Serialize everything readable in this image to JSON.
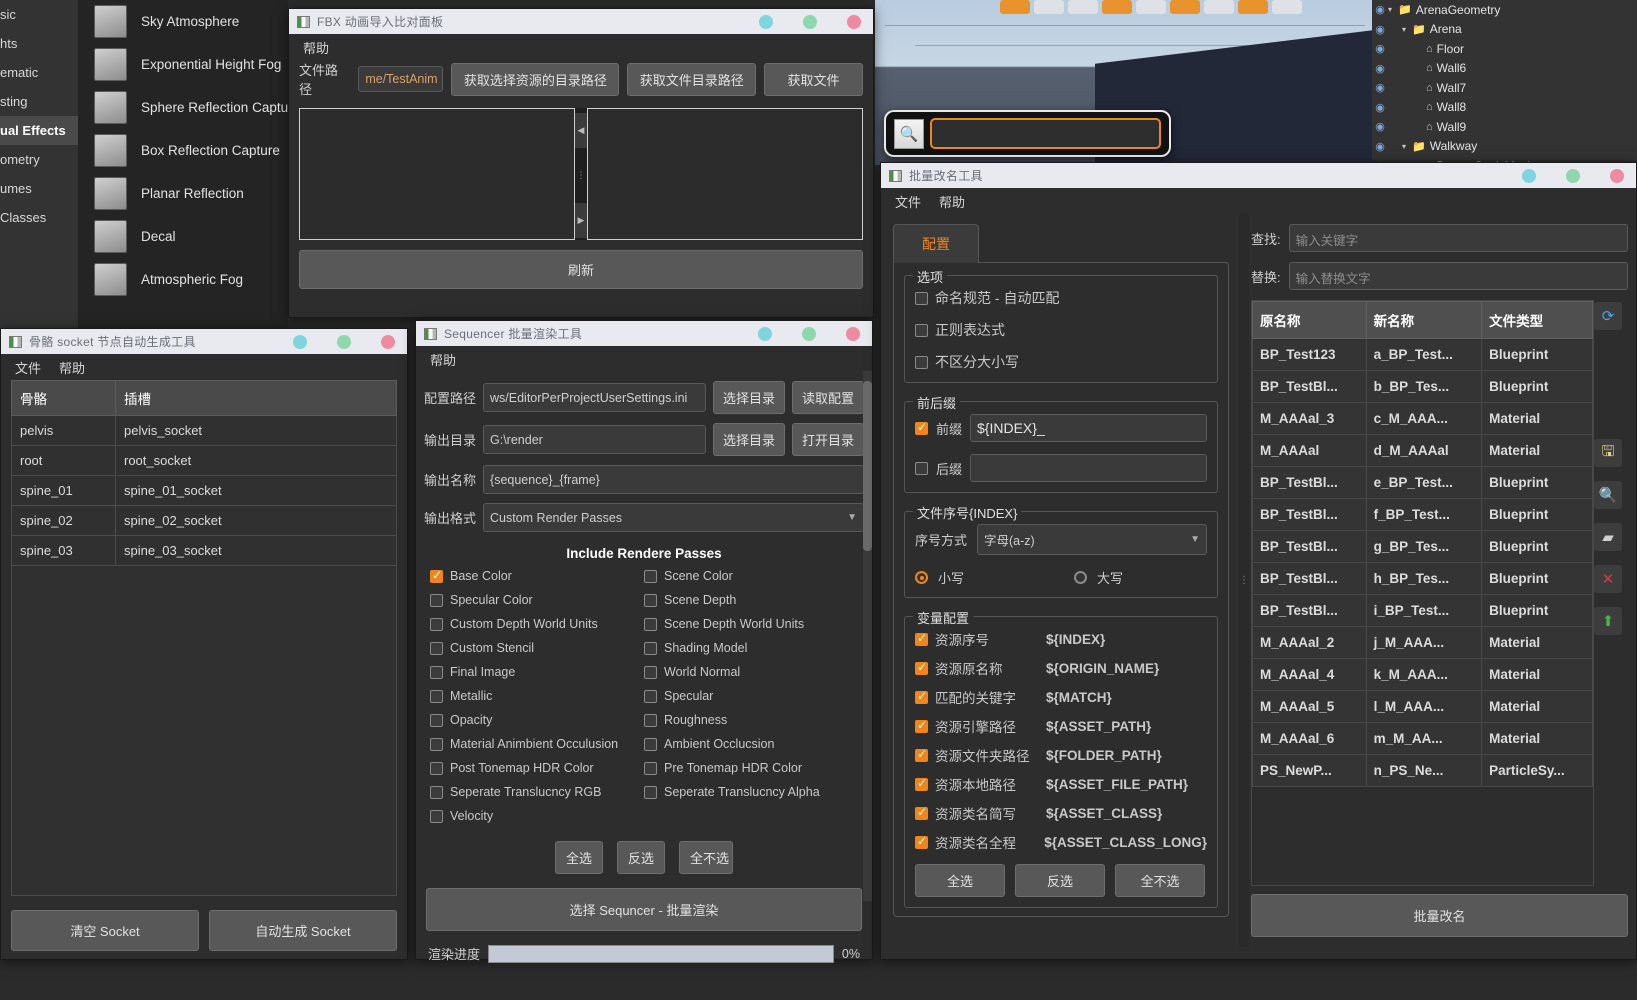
{
  "placement_panel": {
    "categories": [
      {
        "label": "sic",
        "selected": false
      },
      {
        "label": "hts",
        "selected": false
      },
      {
        "label": "ematic",
        "selected": false
      },
      {
        "label": "sting",
        "selected": false
      },
      {
        "label": "ual Effects",
        "selected": true
      },
      {
        "label": "ometry",
        "selected": false
      },
      {
        "label": "umes",
        "selected": false
      },
      {
        "label": "Classes",
        "selected": false
      }
    ],
    "items": [
      {
        "label": "Sky Atmosphere",
        "icon": "sky-atmosphere-icon"
      },
      {
        "label": "Exponential Height Fog",
        "icon": "height-fog-icon"
      },
      {
        "label": "Sphere Reflection Capture",
        "icon": "sphere-reflection-icon"
      },
      {
        "label": "Box Reflection Capture",
        "icon": "box-reflection-icon"
      },
      {
        "label": "Planar Reflection",
        "icon": "planar-reflection-icon"
      },
      {
        "label": "Decal",
        "icon": "decal-icon"
      },
      {
        "label": "Atmospheric Fog",
        "icon": "atmospheric-fog-icon"
      }
    ]
  },
  "outliner": {
    "rows": [
      {
        "label": "ArenaGeometry",
        "type": "folder",
        "indent": 0,
        "expander": true
      },
      {
        "label": "Arena",
        "type": "folder",
        "indent": 1,
        "expander": true
      },
      {
        "label": "Floor",
        "type": "mesh",
        "indent": 2,
        "expander": false
      },
      {
        "label": "Wall6",
        "type": "mesh",
        "indent": 2,
        "expander": false
      },
      {
        "label": "Wall7",
        "type": "mesh",
        "indent": 2,
        "expander": false
      },
      {
        "label": "Wall8",
        "type": "mesh",
        "indent": 2,
        "expander": false
      },
      {
        "label": "Wall9",
        "type": "mesh",
        "indent": 2,
        "expander": false
      },
      {
        "label": "Walkway",
        "type": "folder",
        "indent": 1,
        "expander": true
      },
      {
        "label": "Bump_StaticMesh",
        "type": "mesh",
        "indent": 2,
        "expander": false
      }
    ]
  },
  "search_overlay": {
    "icon": "asset-search-icon",
    "value": "",
    "placeholder": ""
  },
  "fbx_window": {
    "title": "FBX 动画导入比对面板",
    "menu": [
      "帮助"
    ],
    "path_label": "文件路径",
    "path_value": "me/TestAnim",
    "buttons": [
      "获取选择资源的目录路径",
      "获取文件目录路径",
      "获取文件"
    ],
    "refresh_label": "刷新"
  },
  "socket_window": {
    "title": "骨骼 socket 节点自动生成工具",
    "menu": [
      "文件",
      "帮助"
    ],
    "columns": [
      "骨骼",
      "插槽"
    ],
    "rows": [
      [
        "pelvis",
        "pelvis_socket"
      ],
      [
        "root",
        "root_socket"
      ],
      [
        "spine_01",
        "spine_01_socket"
      ],
      [
        "spine_02",
        "spine_02_socket"
      ],
      [
        "spine_03",
        "spine_03_socket"
      ]
    ],
    "buttons": [
      "清空 Socket",
      "自动生成 Socket"
    ]
  },
  "sequencer_window": {
    "title": "Sequencer 批量渲染工具",
    "menu": [
      "帮助"
    ],
    "fields": [
      {
        "label": "配置路径",
        "value": "ws/EditorPerProjectUserSettings.ini",
        "buttons": [
          "选择目录",
          "读取配置"
        ]
      },
      {
        "label": "输出目录",
        "value": "G:\\render",
        "buttons": [
          "选择目录",
          "打开目录"
        ]
      },
      {
        "label": "输出名称",
        "value": "{sequence}_{frame}",
        "buttons": []
      },
      {
        "label": "输出格式",
        "value": "Custom Render Passes",
        "buttons": [],
        "is_select": true
      }
    ],
    "passes_title": "Include Rendere Passes",
    "passes_left": [
      {
        "label": "Base Color",
        "checked": true
      },
      {
        "label": "Specular Color",
        "checked": false
      },
      {
        "label": "Custom Depth World Units",
        "checked": false
      },
      {
        "label": "Custom Stencil",
        "checked": false
      },
      {
        "label": "Final Image",
        "checked": false
      },
      {
        "label": "Metallic",
        "checked": false
      },
      {
        "label": "Opacity",
        "checked": false
      },
      {
        "label": "Material Animbient Occulusion",
        "checked": false
      },
      {
        "label": "Post Tonemap HDR Color",
        "checked": false
      },
      {
        "label": "Seperate Translucncy RGB",
        "checked": false
      },
      {
        "label": "Velocity",
        "checked": false
      }
    ],
    "passes_right": [
      {
        "label": "Scene Color",
        "checked": false
      },
      {
        "label": "Scene Depth",
        "checked": false
      },
      {
        "label": "Scene Depth World Units",
        "checked": false
      },
      {
        "label": "Shading Model",
        "checked": false
      },
      {
        "label": "World Normal",
        "checked": false
      },
      {
        "label": "Specular",
        "checked": false
      },
      {
        "label": "Roughness",
        "checked": false
      },
      {
        "label": "Ambient Occlucsion",
        "checked": false
      },
      {
        "label": "Pre Tonemap HDR Color",
        "checked": false
      },
      {
        "label": "Seperate Translucncy Alpha",
        "checked": false
      }
    ],
    "select_buttons": [
      "全选",
      "反选",
      "全不选"
    ],
    "render_button": "选择 Sequncer - 批量渲染",
    "progress_label": "渲染进度",
    "progress_percent": "0%",
    "progress_value": 0
  },
  "rename_window": {
    "title": "批量改名工具",
    "menu": [
      "文件",
      "帮助"
    ],
    "tab": "配置",
    "options_group": {
      "title": "选项",
      "items": [
        {
          "label": "命名规范 - 自动匹配",
          "checked": false
        },
        {
          "label": "正则表达式",
          "checked": false
        },
        {
          "label": "不区分大小写",
          "checked": false
        }
      ]
    },
    "affix_group": {
      "title": "前后缀",
      "prefix": {
        "label": "前缀",
        "checked": true,
        "value": "${INDEX}_"
      },
      "suffix": {
        "label": "后缀",
        "checked": false,
        "value": ""
      }
    },
    "index_group": {
      "title": "文件序号{INDEX}",
      "mode_label": "序号方式",
      "mode_value": "字母(a-z)",
      "radios": [
        {
          "label": "小写",
          "checked": true
        },
        {
          "label": "大写",
          "checked": false
        }
      ]
    },
    "variable_group": {
      "title": "变量配置",
      "items": [
        {
          "label": "资源序号",
          "token": "${INDEX}",
          "checked": true
        },
        {
          "label": "资源原名称",
          "token": "${ORIGIN_NAME}",
          "checked": true
        },
        {
          "label": "匹配的关键字",
          "token": "${MATCH}",
          "checked": true
        },
        {
          "label": "资源引擎路径",
          "token": "${ASSET_PATH}",
          "checked": true
        },
        {
          "label": "资源文件夹路径",
          "token": "${FOLDER_PATH}",
          "checked": true
        },
        {
          "label": "资源本地路径",
          "token": "${ASSET_FILE_PATH}",
          "checked": true
        },
        {
          "label": "资源类名简写",
          "token": "${ASSET_CLASS}",
          "checked": true
        },
        {
          "label": "资源类名全程",
          "token": "${ASSET_CLASS_LONG}",
          "checked": true
        }
      ],
      "buttons": [
        "全选",
        "反选",
        "全不选"
      ]
    },
    "find_label": "查找:",
    "find_placeholder": "输入关键字",
    "replace_label": "替换:",
    "replace_placeholder": "输入替换文字",
    "table": {
      "columns": [
        "原名称",
        "新名称",
        "文件类型"
      ],
      "rows": [
        [
          "BP_Test123",
          "a_BP_Test...",
          "Blueprint"
        ],
        [
          "BP_TestBl...",
          "b_BP_Tes...",
          "Blueprint"
        ],
        [
          "M_AAAal_3",
          "c_M_AAA...",
          "Material"
        ],
        [
          "M_AAAal",
          "d_M_AAAal",
          "Material"
        ],
        [
          "BP_TestBl...",
          "e_BP_Test...",
          "Blueprint"
        ],
        [
          "BP_TestBl...",
          "f_BP_Test...",
          "Blueprint"
        ],
        [
          "BP_TestBl...",
          "g_BP_Tes...",
          "Blueprint"
        ],
        [
          "BP_TestBl...",
          "h_BP_Tes...",
          "Blueprint"
        ],
        [
          "BP_TestBl...",
          "i_BP_Test...",
          "Blueprint"
        ],
        [
          "M_AAAal_2",
          "j_M_AAA...",
          "Material"
        ],
        [
          "M_AAAal_4",
          "k_M_AAA...",
          "Material"
        ],
        [
          "M_AAAal_5",
          "l_M_AAA...",
          "Material"
        ],
        [
          "M_AAAal_6",
          "m_M_AA...",
          "Material"
        ],
        [
          "PS_NewP...",
          "n_PS_Ne...",
          "ParticleSy..."
        ]
      ]
    },
    "side_icons": [
      {
        "name": "refresh-icon",
        "glyph": "⟳",
        "color": "#4aa3e0"
      },
      {
        "name": "save-asset-icon",
        "glyph": "🖫",
        "color": "#ddd58a"
      },
      {
        "name": "find-asset-icon",
        "glyph": "🔍",
        "color": "#9bc9ea"
      },
      {
        "name": "layers-icon",
        "glyph": "▰",
        "color": "#cfcfcf"
      },
      {
        "name": "delete-icon",
        "glyph": "✕",
        "color": "#d63b3b"
      },
      {
        "name": "upload-icon",
        "glyph": "⬆",
        "color": "#49b24a"
      }
    ],
    "rename_button": "批量改名"
  }
}
